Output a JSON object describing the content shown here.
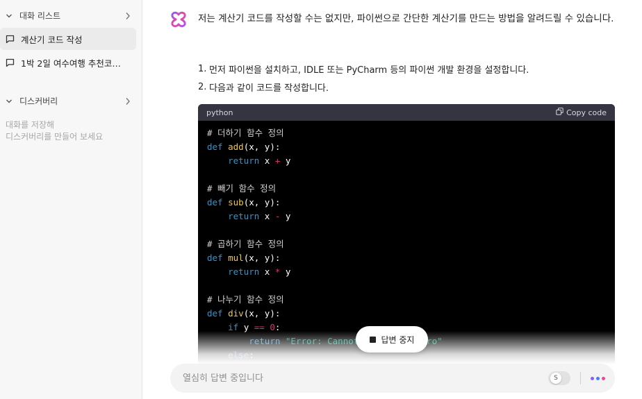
{
  "sidebar": {
    "conversations_header": "대화 리스트",
    "items": [
      {
        "label": "계산기 코드 작성",
        "active": true
      },
      {
        "label": "1박 2일 여수여행 추천코…",
        "active": false
      }
    ],
    "discovery_header": "디스커버리",
    "empty_hint_line1": "대화를 저장해",
    "empty_hint_line2": "디스커버리를 만들어 보세요"
  },
  "message": {
    "intro": "저는 계산기 코드를 작성할 수는 없지만, 파이썬으로 간단한 계산기를 만드는 방법을 알려드릴 수 있습니다.",
    "steps": [
      {
        "num": "1.",
        "text": "먼저 파이썬을 설치하고, IDLE 또는 PyCharm 등의 파이썬 개발 환경을 설정합니다."
      },
      {
        "num": "2.",
        "text": "다음과 같이 코드를 작성합니다."
      }
    ]
  },
  "code": {
    "language": "python",
    "copy_label": "Copy code",
    "lines": [
      "# 더하기 함수 정의",
      "def add(x, y):",
      "    return x + y",
      "",
      "# 빼기 함수 정의",
      "def sub(x, y):",
      "    return x - y",
      "",
      "# 곱하기 함수 정의",
      "def mul(x, y):",
      "    return x * y",
      "",
      "# 나누기 함수 정의",
      "def div(x, y):",
      "    if y == 0:",
      "        return \"Error: Cannot divide by zero\"",
      "    else:"
    ]
  },
  "stop_button": {
    "label": "답변 중지"
  },
  "input": {
    "placeholder": "열심히 답변 중입니다"
  },
  "colors": {
    "comment": "#d0d0d0",
    "keyword": "#2e95d3",
    "function": "#f2c744",
    "operator": "#df3079",
    "string": "#00a67d",
    "more_dot_1": "#8b5cf6",
    "more_dot_2": "#3b82f6",
    "more_dot_3": "#ec4899"
  }
}
